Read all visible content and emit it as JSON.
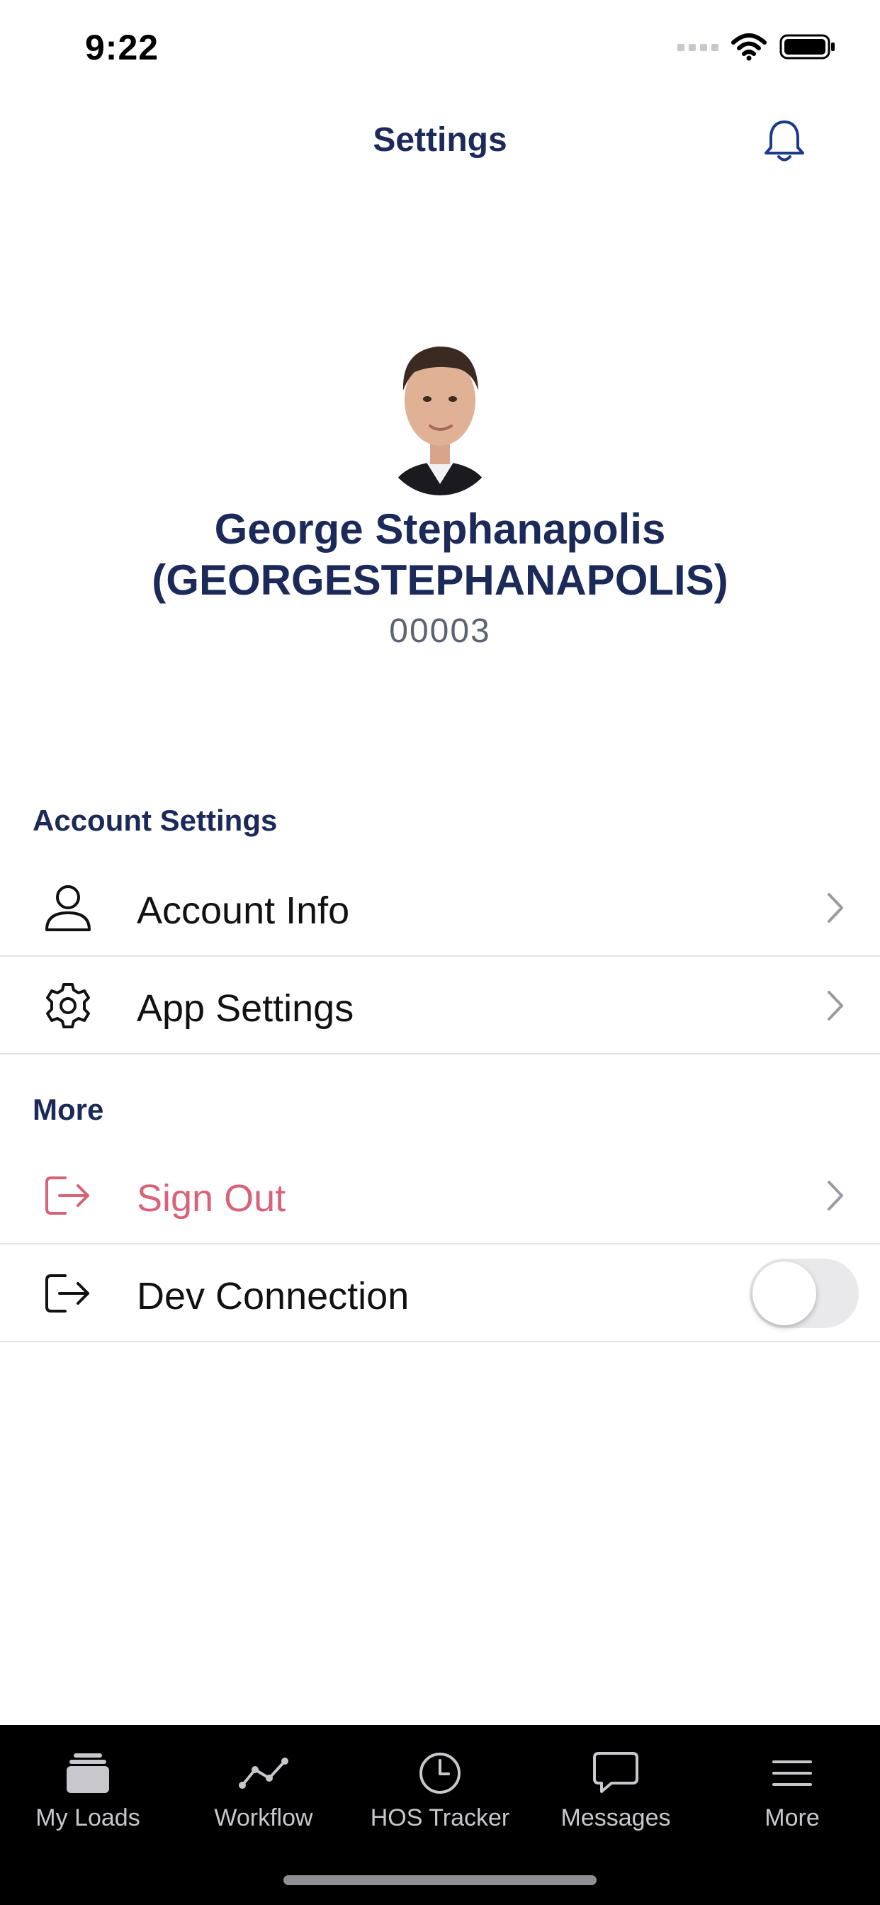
{
  "status_bar": {
    "time": "9:22"
  },
  "nav": {
    "title": "Settings",
    "bell_icon": "bell-icon"
  },
  "profile": {
    "name_line1": "George Stephanapolis",
    "name_line2": "(GEORGESTEPHANAPOLIS)",
    "id": "00003"
  },
  "sections": {
    "account_header": "Account Settings",
    "more_header": "More"
  },
  "rows": {
    "account_info": {
      "label": "Account Info",
      "icon": "person-icon"
    },
    "app_settings": {
      "label": "App Settings",
      "icon": "gear-icon"
    },
    "sign_out": {
      "label": "Sign Out",
      "icon": "sign-out-icon"
    },
    "dev_connection": {
      "label": "Dev Connection",
      "icon": "sign-out-icon",
      "enabled": false
    }
  },
  "tabs": [
    {
      "label": "My Loads",
      "icon": "stack-icon"
    },
    {
      "label": "Workflow",
      "icon": "workflow-icon"
    },
    {
      "label": "HOS Tracker",
      "icon": "clock-icon"
    },
    {
      "label": "Messages",
      "icon": "message-icon"
    },
    {
      "label": "More",
      "icon": "menu-icon"
    }
  ],
  "colors": {
    "primary": "#1c2a59",
    "danger": "#d8627a",
    "divider": "#e4e4e8",
    "tab_bar": "#000000",
    "tab_label": "#c8c8cc"
  }
}
